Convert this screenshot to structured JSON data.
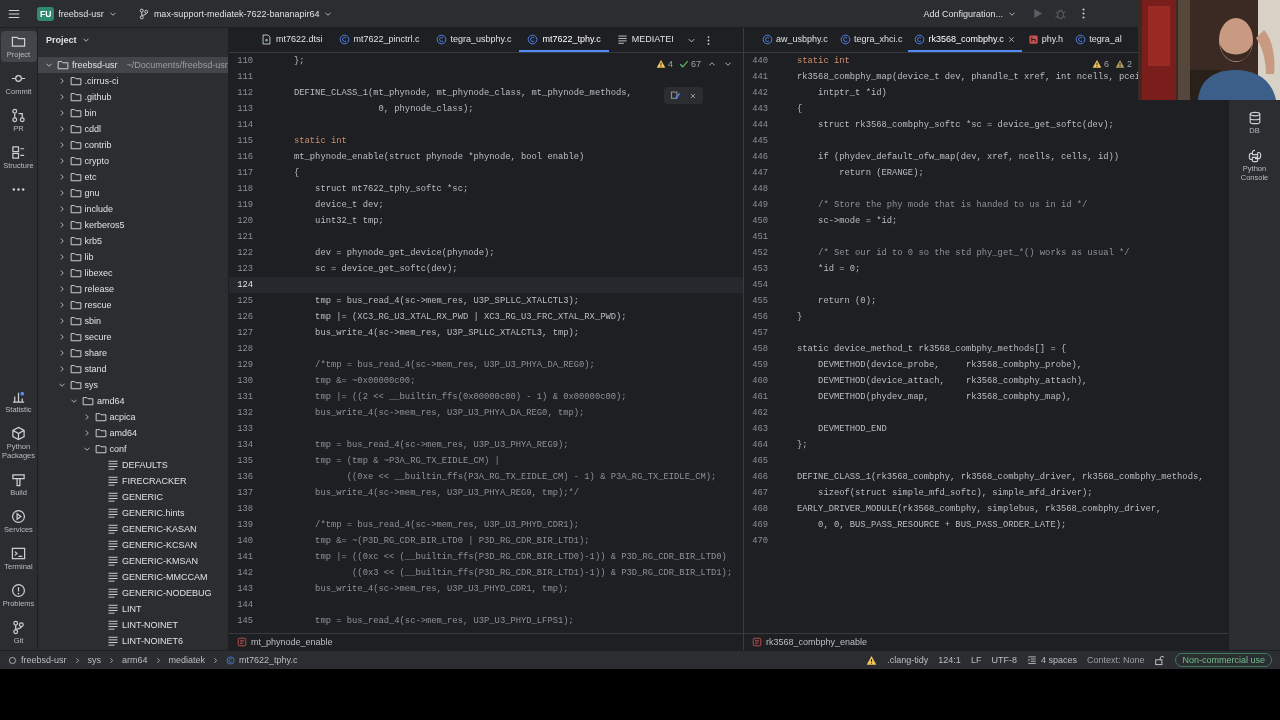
{
  "top_bar": {
    "project_badge": "FU",
    "project": "freebsd-usr",
    "branch": "max-support-mediatek-7622-bananapir64",
    "run_config": "Add Configuration..."
  },
  "left_toolbar": [
    {
      "label": "Project",
      "kind": "folder",
      "selected": true
    },
    {
      "label": "Commit",
      "kind": "commit",
      "selected": false
    },
    {
      "label": "PR",
      "kind": "pull-request",
      "selected": false
    },
    {
      "label": "Structure",
      "kind": "structure",
      "selected": false
    },
    {
      "kind": "more",
      "selected": false
    }
  ],
  "left_toolbar_bottom": [
    {
      "label": "Statistic",
      "kind": "statistic",
      "selected": false
    },
    {
      "label": "Python Packages",
      "kind": "package",
      "selected": false
    },
    {
      "label": "Build",
      "kind": "hammer",
      "selected": false
    },
    {
      "label": "Services",
      "kind": "services",
      "selected": false
    },
    {
      "label": "Terminal",
      "kind": "terminal",
      "selected": false
    },
    {
      "label": "Problems",
      "kind": "problems",
      "selected": false
    },
    {
      "label": "Git",
      "kind": "git-branch",
      "selected": false
    }
  ],
  "project_panel": {
    "title": "Project",
    "tree": [
      {
        "name": "freebsd-usr",
        "path": "~/Documents/freebsd-usr",
        "kind": "folder",
        "expanded": true,
        "selected": true,
        "children": [
          {
            "name": ".cirrus-ci",
            "kind": "folder",
            "expanded": false,
            "selected": false
          },
          {
            "name": ".github",
            "kind": "folder",
            "expanded": false,
            "selected": false
          },
          {
            "name": "bin",
            "kind": "folder",
            "expanded": false,
            "selected": false
          },
          {
            "name": "cddl",
            "kind": "folder",
            "expanded": false,
            "selected": false
          },
          {
            "name": "contrib",
            "kind": "folder",
            "expanded": false,
            "selected": false
          },
          {
            "name": "crypto",
            "kind": "folder",
            "expanded": false,
            "selected": false
          },
          {
            "name": "etc",
            "kind": "folder",
            "expanded": false,
            "selected": false
          },
          {
            "name": "gnu",
            "kind": "folder",
            "expanded": false,
            "selected": false
          },
          {
            "name": "include",
            "kind": "folder",
            "expanded": false,
            "selected": false
          },
          {
            "name": "kerberos5",
            "kind": "folder",
            "expanded": false,
            "selected": false
          },
          {
            "name": "krb5",
            "kind": "folder",
            "expanded": false,
            "selected": false
          },
          {
            "name": "lib",
            "kind": "folder",
            "expanded": false,
            "selected": false
          },
          {
            "name": "libexec",
            "kind": "folder",
            "expanded": false,
            "selected": false
          },
          {
            "name": "release",
            "kind": "folder",
            "expanded": false,
            "selected": false
          },
          {
            "name": "rescue",
            "kind": "folder",
            "expanded": false,
            "selected": false
          },
          {
            "name": "sbin",
            "kind": "folder",
            "expanded": false,
            "selected": false
          },
          {
            "name": "secure",
            "kind": "folder",
            "expanded": false,
            "selected": false
          },
          {
            "name": "share",
            "kind": "folder",
            "expanded": false,
            "selected": false
          },
          {
            "name": "stand",
            "kind": "folder",
            "expanded": false,
            "selected": false
          },
          {
            "name": "sys",
            "kind": "folder",
            "expanded": true,
            "selected": false,
            "children": [
              {
                "name": "amd64",
                "kind": "folder",
                "expanded": true,
                "selected": false,
                "children": [
                  {
                    "name": "acpica",
                    "kind": "folder",
                    "expanded": false,
                    "selected": false
                  },
                  {
                    "name": "amd64",
                    "kind": "folder",
                    "expanded": false,
                    "selected": false
                  },
                  {
                    "name": "conf",
                    "kind": "folder",
                    "expanded": true,
                    "selected": false,
                    "children": [
                      {
                        "name": "DEFAULTS",
                        "kind": "file",
                        "selected": false
                      },
                      {
                        "name": "FIRECRACKER",
                        "kind": "file",
                        "selected": false
                      },
                      {
                        "name": "GENERIC",
                        "kind": "file",
                        "selected": false
                      },
                      {
                        "name": "GENERIC.hints",
                        "kind": "file",
                        "selected": false
                      },
                      {
                        "name": "GENERIC-KASAN",
                        "kind": "file",
                        "selected": false
                      },
                      {
                        "name": "GENERIC-KCSAN",
                        "kind": "file",
                        "selected": false
                      },
                      {
                        "name": "GENERIC-KMSAN",
                        "kind": "file",
                        "selected": false
                      },
                      {
                        "name": "GENERIC-MMCCAM",
                        "kind": "file",
                        "selected": false
                      },
                      {
                        "name": "GENERIC-NODEBUG",
                        "kind": "file",
                        "selected": false
                      },
                      {
                        "name": "LINT",
                        "kind": "file",
                        "selected": false
                      },
                      {
                        "name": "LINT-NOINET",
                        "kind": "file",
                        "selected": false
                      },
                      {
                        "name": "LINT-NOINET6",
                        "kind": "file",
                        "selected": false
                      }
                    ]
                  }
                ]
              }
            ]
          }
        ]
      }
    ]
  },
  "editors": [
    {
      "tabs": [
        {
          "label": "mt7622.dtsi",
          "kind": "dtsi-file",
          "selected": false
        },
        {
          "label": "mt7622_pinctrl.c",
          "kind": "c-file",
          "selected": false
        },
        {
          "label": "tegra_usbphy.c",
          "kind": "c-file",
          "selected": false
        },
        {
          "label": "mt7622_tphy.c",
          "kind": "c-file",
          "selected": true
        },
        {
          "label": "MEDIATEI",
          "kind": "text-file",
          "selected": false
        }
      ],
      "tab_menu": true,
      "inspections": [
        {
          "kind": "warning",
          "count": "4"
        },
        {
          "kind": "check",
          "count": "67"
        }
      ],
      "hint_popup": true,
      "lines": [
        {
          "number": "110",
          "kind": "code",
          "text": "};",
          "current": false
        },
        {
          "number": "111",
          "current": false
        },
        {
          "number": "112",
          "kind": "code",
          "text": "DEFINE_CLASS_1(mt_phynode, mt_phynode_class, mt_phynode_methods,",
          "current": false
        },
        {
          "number": "113",
          "kind": "code",
          "text": "                0, phynode_class);",
          "current": false
        },
        {
          "number": "114",
          "current": false
        },
        {
          "number": "115",
          "kind": "keyword",
          "text": "static int",
          "current": false
        },
        {
          "number": "116",
          "kind": "code",
          "text": "mt_phynode_enable(struct phynode *phynode, bool enable)",
          "current": false
        },
        {
          "number": "117",
          "kind": "code",
          "text": "{",
          "current": false
        },
        {
          "number": "118",
          "kind": "code",
          "text": "    struct mt7622_tphy_softc *sc;",
          "current": false
        },
        {
          "number": "119",
          "kind": "code",
          "text": "    device_t dev;",
          "current": false
        },
        {
          "number": "120",
          "kind": "code",
          "text": "    uint32_t tmp;",
          "current": false
        },
        {
          "number": "121",
          "current": false
        },
        {
          "number": "122",
          "kind": "code",
          "text": "    dev = phynode_get_device(phynode);",
          "current": false
        },
        {
          "number": "123",
          "kind": "code",
          "text": "    sc = device_get_softc(dev);",
          "current": false
        },
        {
          "number": "124",
          "current": true
        },
        {
          "number": "125",
          "kind": "code",
          "text": "    tmp = bus_read_4(sc->mem_res, U3P_SPLLC_XTALCTL3);",
          "current": false
        },
        {
          "number": "126",
          "kind": "code",
          "text": "    tmp |= (XC3_RG_U3_XTAL_RX_PWD | XC3_RG_U3_FRC_XTAL_RX_PWD);",
          "current": false
        },
        {
          "number": "127",
          "kind": "code",
          "text": "    bus_write_4(sc->mem_res, U3P_SPLLC_XTALCTL3, tmp);",
          "current": false
        },
        {
          "number": "128",
          "current": false
        },
        {
          "number": "129",
          "kind": "comment",
          "text": "    /*tmp = bus_read_4(sc->mem_res, U3P_U3_PHYA_DA_REG0);",
          "current": false
        },
        {
          "number": "130",
          "kind": "comment",
          "text": "    tmp &= ~0x00000c00;",
          "current": false
        },
        {
          "number": "131",
          "kind": "comment",
          "text": "    tmp |= ((2 << __builtin_ffs(0x00000c00) - 1) & 0x00000c00);",
          "current": false
        },
        {
          "number": "132",
          "kind": "comment",
          "text": "    bus_write_4(sc->mem_res, U3P_U3_PHYA_DA_REG0, tmp);",
          "current": false
        },
        {
          "number": "133",
          "current": false
        },
        {
          "number": "134",
          "kind": "comment",
          "text": "    tmp = bus_read_4(sc->mem_res, U3P_U3_PHYA_REG9);",
          "current": false
        },
        {
          "number": "135",
          "kind": "comment",
          "text": "    tmp = (tmp & ~P3A_RG_TX_EIDLE_CM) |",
          "current": false
        },
        {
          "number": "136",
          "kind": "comment",
          "text": "          ((0xe << __builtin_ffs(P3A_RG_TX_EIDLE_CM) - 1) & P3A_RG_TX_EIDLE_CM);",
          "current": false
        },
        {
          "number": "137",
          "kind": "comment",
          "text": "    bus_write_4(sc->mem_res, U3P_U3_PHYA_REG9, tmp);*/",
          "current": false
        },
        {
          "number": "138",
          "current": false
        },
        {
          "number": "139",
          "kind": "comment",
          "text": "    /*tmp = bus_read_4(sc->mem_res, U3P_U3_PHYD_CDR1);",
          "current": false
        },
        {
          "number": "140",
          "kind": "comment",
          "text": "    tmp &= ~(P3D_RG_CDR_BIR_LTD0 | P3D_RG_CDR_BIR_LTD1);",
          "current": false
        },
        {
          "number": "141",
          "kind": "comment",
          "text": "    tmp |= ((0xc << (__builtin_ffs(P3D_RG_CDR_BIR_LTD0)-1)) & P3D_RG_CDR_BIR_LTD0)",
          "current": false
        },
        {
          "number": "142",
          "kind": "comment",
          "text": "           ((0x3 << (__builtin_ffs(P3D_RG_CDR_BIR_LTD1)-1)) & P3D_RG_CDR_BIR_LTD1);",
          "current": false
        },
        {
          "number": "143",
          "kind": "comment",
          "text": "    bus_write_4(sc->mem_res, U3P_U3_PHYD_CDR1, tmp);",
          "current": false
        },
        {
          "number": "144",
          "current": false
        },
        {
          "number": "145",
          "kind": "comment",
          "text": "    tmp = bus_read_4(sc->mem_res, U3P_U3_PHYD_LFPS1);",
          "current": false
        }
      ],
      "breadcrumb": "mt_phynode_enable"
    },
    {
      "tabs": [
        {
          "label": "aw_usbphy.c",
          "kind": "c-file",
          "selected": false
        },
        {
          "label": "tegra_xhci.c",
          "kind": "c-file",
          "selected": false
        },
        {
          "label": "rk3568_combphy.c",
          "kind": "c-file",
          "selected": true
        },
        {
          "label": "phy.h",
          "kind": "h-file",
          "selected": false
        },
        {
          "label": "tegra_al",
          "kind": "c-file",
          "selected": false
        }
      ],
      "inspections": [
        {
          "kind": "warning",
          "count": "6"
        },
        {
          "kind": "weak-warning",
          "count": "2"
        }
      ],
      "lines": [
        {
          "number": "440",
          "kind": "keyword",
          "text": "static int",
          "current": false
        },
        {
          "number": "441",
          "kind": "code",
          "text": "rk3568_combphy_map(device_t dev, phandle_t xref, int ncells, pcei",
          "current": false
        },
        {
          "number": "442",
          "kind": "code",
          "text": "    intptr_t *id)",
          "current": false
        },
        {
          "number": "443",
          "kind": "code",
          "text": "{",
          "current": false
        },
        {
          "number": "444",
          "kind": "code",
          "text": "    struct rk3568_combphy_softc *sc = device_get_softc(dev);",
          "current": false
        },
        {
          "number": "445",
          "current": false
        },
        {
          "number": "446",
          "kind": "code",
          "text": "    if (phydev_default_ofw_map(dev, xref, ncells, cells, id))",
          "current": false
        },
        {
          "number": "447",
          "kind": "code",
          "text": "        return (ERANGE);",
          "current": false
        },
        {
          "number": "448",
          "current": false
        },
        {
          "number": "449",
          "kind": "comment",
          "text": "    /* Store the phy mode that is handed to us in id */",
          "current": false
        },
        {
          "number": "450",
          "kind": "code",
          "text": "    sc->mode = *id;",
          "current": false
        },
        {
          "number": "451",
          "current": false
        },
        {
          "number": "452",
          "kind": "comment",
          "text": "    /* Set our id to 0 so the std phy_get_*() works as usual */",
          "current": false
        },
        {
          "number": "453",
          "kind": "code",
          "text": "    *id = 0;",
          "current": false
        },
        {
          "number": "454",
          "current": false
        },
        {
          "number": "455",
          "kind": "code",
          "text": "    return (0);",
          "current": false
        },
        {
          "number": "456",
          "kind": "code",
          "text": "}",
          "current": false
        },
        {
          "number": "457",
          "current": false
        },
        {
          "number": "458",
          "kind": "code",
          "text": "static device_method_t rk3568_combphy_methods[] = {",
          "current": false
        },
        {
          "number": "459",
          "kind": "code",
          "text": "    DEVMETHOD(device_probe,     rk3568_combphy_probe),",
          "current": false
        },
        {
          "number": "460",
          "kind": "code",
          "text": "    DEVMETHOD(device_attach,    rk3568_combphy_attach),",
          "current": false
        },
        {
          "number": "461",
          "kind": "code",
          "text": "    DEVMETHOD(phydev_map,       rk3568_combphy_map),",
          "current": false
        },
        {
          "number": "462",
          "current": false
        },
        {
          "number": "463",
          "kind": "code",
          "text": "    DEVMETHOD_END",
          "current": false
        },
        {
          "number": "464",
          "kind": "code",
          "text": "};",
          "current": false
        },
        {
          "number": "465",
          "current": false
        },
        {
          "number": "466",
          "kind": "code",
          "text": "DEFINE_CLASS_1(rk3568_combphy, rk3568_combphy_driver, rk3568_combphy_methods,",
          "current": false
        },
        {
          "number": "467",
          "kind": "code",
          "text": "    sizeof(struct simple_mfd_softc), simple_mfd_driver);",
          "current": false
        },
        {
          "number": "468",
          "kind": "code",
          "text": "EARLY_DRIVER_MODULE(rk3568_combphy, simplebus, rk3568_combphy_driver,",
          "current": false
        },
        {
          "number": "469",
          "kind": "code",
          "text": "    0, 0, BUS_PASS_RESOURCE + BUS_PASS_ORDER_LATE);",
          "current": false
        },
        {
          "number": "470",
          "current": false
        }
      ],
      "breadcrumb": "rk3568_combphy_enable"
    }
  ],
  "right_toolbar": [
    {
      "label": "DB",
      "kind": "database"
    },
    {
      "label": "Python Console",
      "kind": "python"
    }
  ],
  "status_bar": {
    "path": [
      "freebsd-usr",
      "sys",
      "arm64",
      "mediatek",
      "mt7622_tphy.c"
    ],
    "linter": ".clang-tidy",
    "position": "124:1",
    "line_ending": "LF",
    "encoding": "UTF-8",
    "indent": "4 spaces",
    "context": "Context: None",
    "license": "Non-commercial use"
  }
}
